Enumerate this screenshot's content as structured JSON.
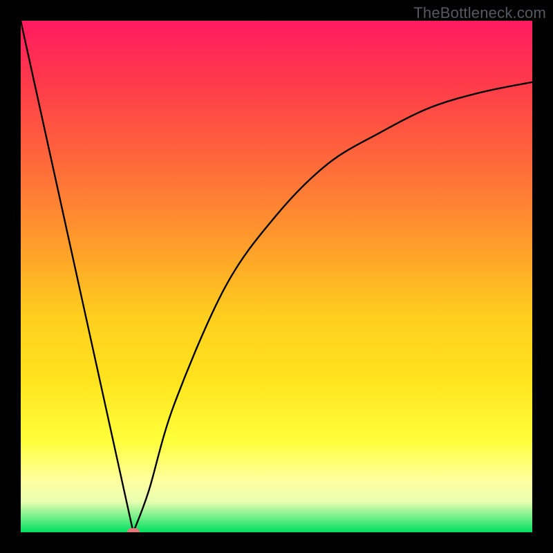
{
  "watermark": "TheBottleneck.com",
  "chart_data": {
    "type": "line",
    "title": "",
    "xlabel": "",
    "ylabel": "",
    "xlim": [
      0,
      100
    ],
    "ylim": [
      0,
      100
    ],
    "grid": false,
    "background": "rainbow-gradient",
    "curve_points": [
      {
        "x": 0,
        "y": 100
      },
      {
        "x": 22,
        "y": 0
      },
      {
        "x": 25,
        "y": 8
      },
      {
        "x": 30,
        "y": 25
      },
      {
        "x": 40,
        "y": 48
      },
      {
        "x": 50,
        "y": 62
      },
      {
        "x": 60,
        "y": 72
      },
      {
        "x": 70,
        "y": 78
      },
      {
        "x": 80,
        "y": 83
      },
      {
        "x": 90,
        "y": 86
      },
      {
        "x": 100,
        "y": 88
      }
    ],
    "marker": {
      "x": 22,
      "y": 0
    }
  },
  "colors": {
    "curve": "#000000",
    "marker": "#e07878",
    "frame": "#000000"
  }
}
